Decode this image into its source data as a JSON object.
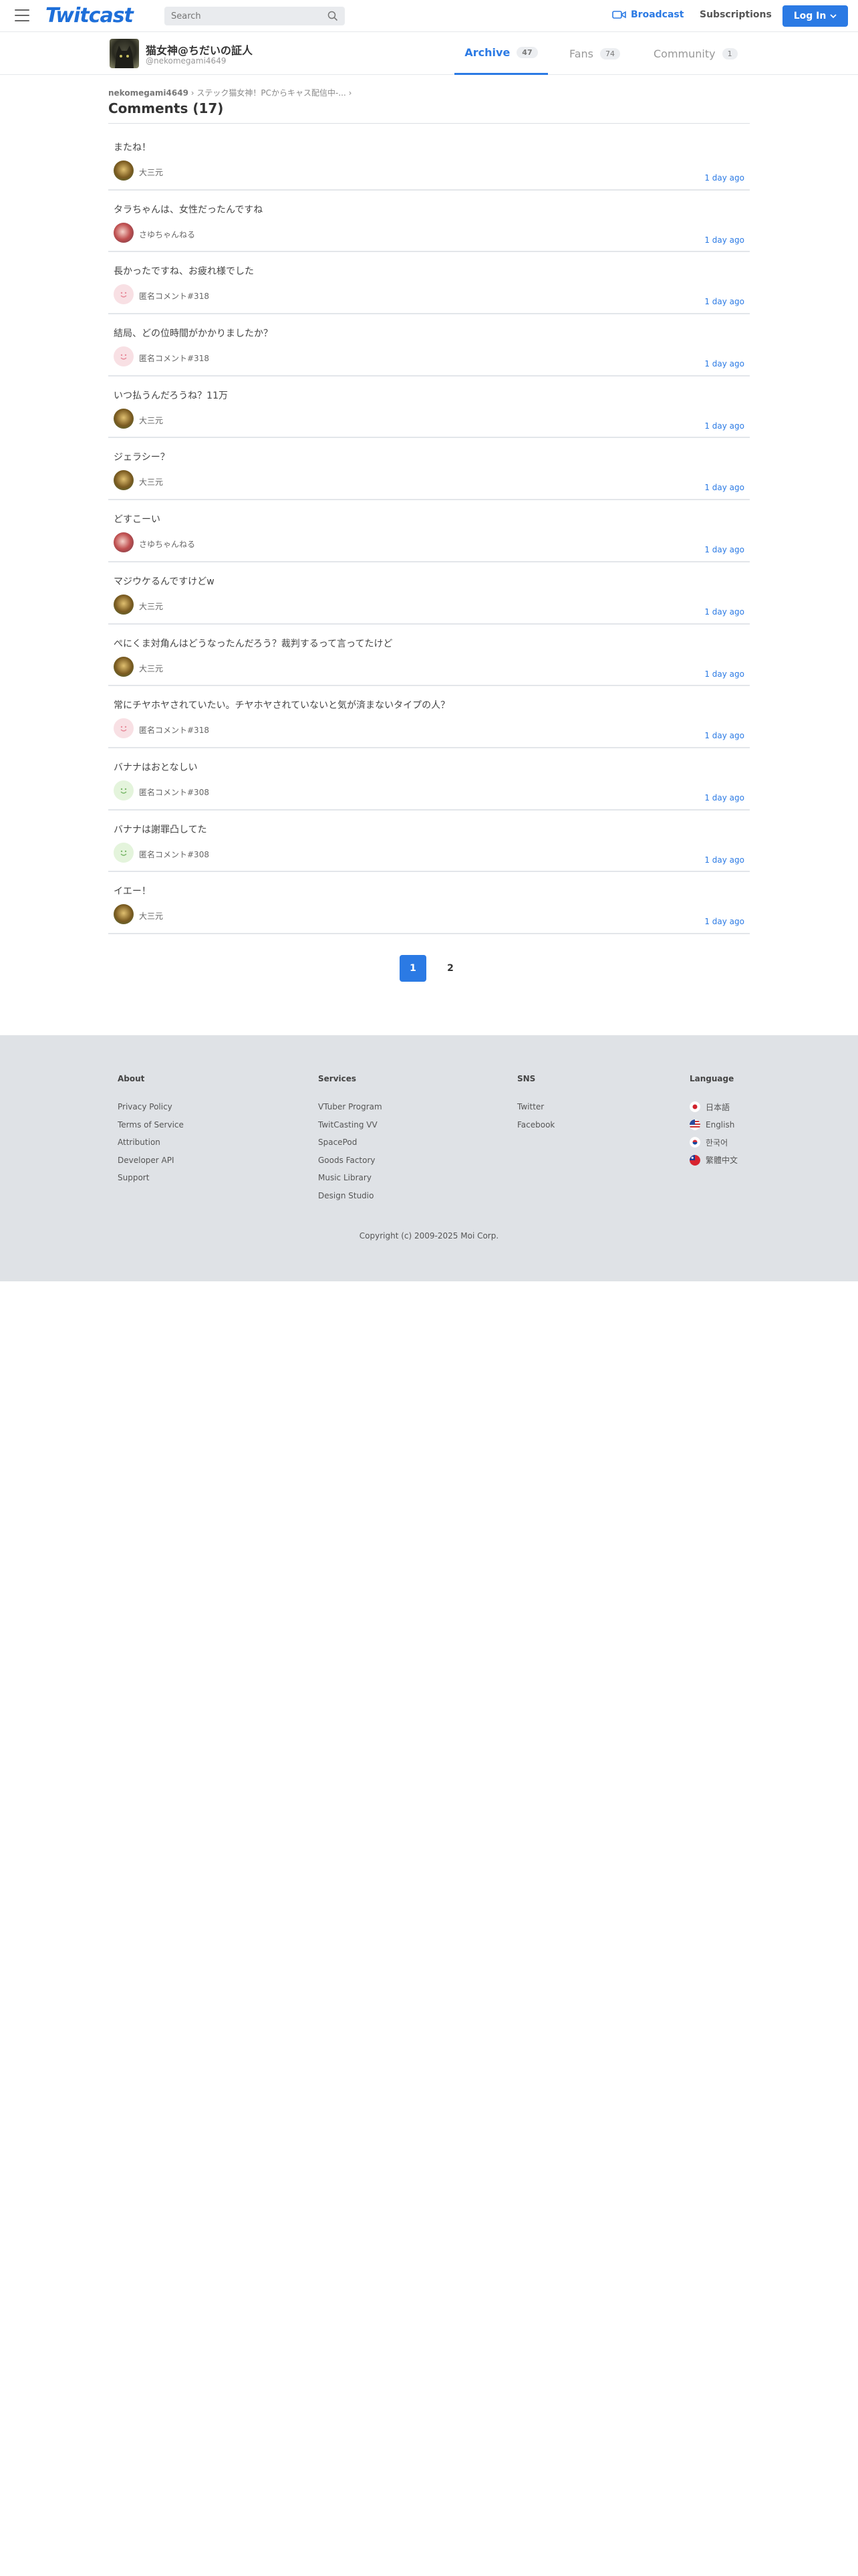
{
  "header": {
    "logo": "Twitcast",
    "search_placeholder": "Search",
    "broadcast_label": "Broadcast",
    "subscriptions_label": "Subscriptions",
    "login_label": "Log In",
    "accent_color": "#2b7ae4"
  },
  "profile": {
    "name": "猫女神@ちだいの証人",
    "handle": "@nekomegami4649"
  },
  "tabs": [
    {
      "label": "Archive",
      "count": "47",
      "active": true
    },
    {
      "label": "Fans",
      "count": "74",
      "active": false
    },
    {
      "label": "Community",
      "count": "1",
      "active": false
    }
  ],
  "breadcrumb": {
    "first": "nekomegami4649",
    "sep1": "›",
    "second": "ステック猫女神！PCからキャス配信中-...",
    "sep2": "›"
  },
  "page_title": "Comments (17)",
  "comments": [
    {
      "text": "またね！",
      "author": "大三元",
      "time": "1 day ago",
      "avatar": "dai"
    },
    {
      "text": "タラちゃんは、女性だったんですね",
      "author": "さゆちゃんねる",
      "time": "1 day ago",
      "avatar": "sayu"
    },
    {
      "text": "長かったですね、お疲れ様でした",
      "author": "匿名コメント#318",
      "time": "1 day ago",
      "avatar": "anon"
    },
    {
      "text": "結局、どの位時間がかかりましたか？",
      "author": "匿名コメント#318",
      "time": "1 day ago",
      "avatar": "anon"
    },
    {
      "text": "いつ払うんだろうね？11万",
      "author": "大三元",
      "time": "1 day ago",
      "avatar": "dai"
    },
    {
      "text": "ジェラシー？",
      "author": "大三元",
      "time": "1 day ago",
      "avatar": "dai"
    },
    {
      "text": "どすこーい",
      "author": "さゆちゃんねる",
      "time": "1 day ago",
      "avatar": "sayu"
    },
    {
      "text": "マジウケるんですけどw",
      "author": "大三元",
      "time": "1 day ago",
      "avatar": "dai"
    },
    {
      "text": "ぺにくま対角んはどうなったんだろう？裁判するって言ってたけど",
      "author": "大三元",
      "time": "1 day ago",
      "avatar": "dai"
    },
    {
      "text": "常にチヤホヤされていたい。チヤホヤされていないと気が済まないタイプの人？",
      "author": "匿名コメント#318",
      "time": "1 day ago",
      "avatar": "anon"
    },
    {
      "text": "バナナはおとなしい",
      "author": "匿名コメント#308",
      "time": "1 day ago",
      "avatar": "anon-green"
    },
    {
      "text": "バナナは謝罪凸してた",
      "author": "匿名コメント#308",
      "time": "1 day ago",
      "avatar": "anon-green"
    },
    {
      "text": "イエー！",
      "author": "大三元",
      "time": "1 day ago",
      "avatar": "dai"
    }
  ],
  "pagination": [
    "1",
    "2"
  ],
  "footer": {
    "about": {
      "title": "About",
      "items": [
        "Privacy Policy",
        "Terms of Service",
        "Attribution",
        "Developer API",
        "Support"
      ]
    },
    "services": {
      "title": "Services",
      "items": [
        "VTuber Program",
        "TwitCasting VV",
        "SpacePod",
        "Goods Factory",
        "Music Library",
        "Design Studio"
      ]
    },
    "sns": {
      "title": "SNS",
      "items": [
        "Twitter",
        "Facebook"
      ]
    },
    "language": {
      "title": "Language",
      "items": [
        {
          "label": "日本語",
          "flag": "jp-flag-icon"
        },
        {
          "label": "English",
          "flag": "us-flag-icon"
        },
        {
          "label": "한국어",
          "flag": "kr-flag-icon"
        },
        {
          "label": "繁體中文",
          "flag": "tw-flag-icon"
        }
      ]
    },
    "copyright": "Copyright (c) 2009-2025 Moi Corp."
  }
}
